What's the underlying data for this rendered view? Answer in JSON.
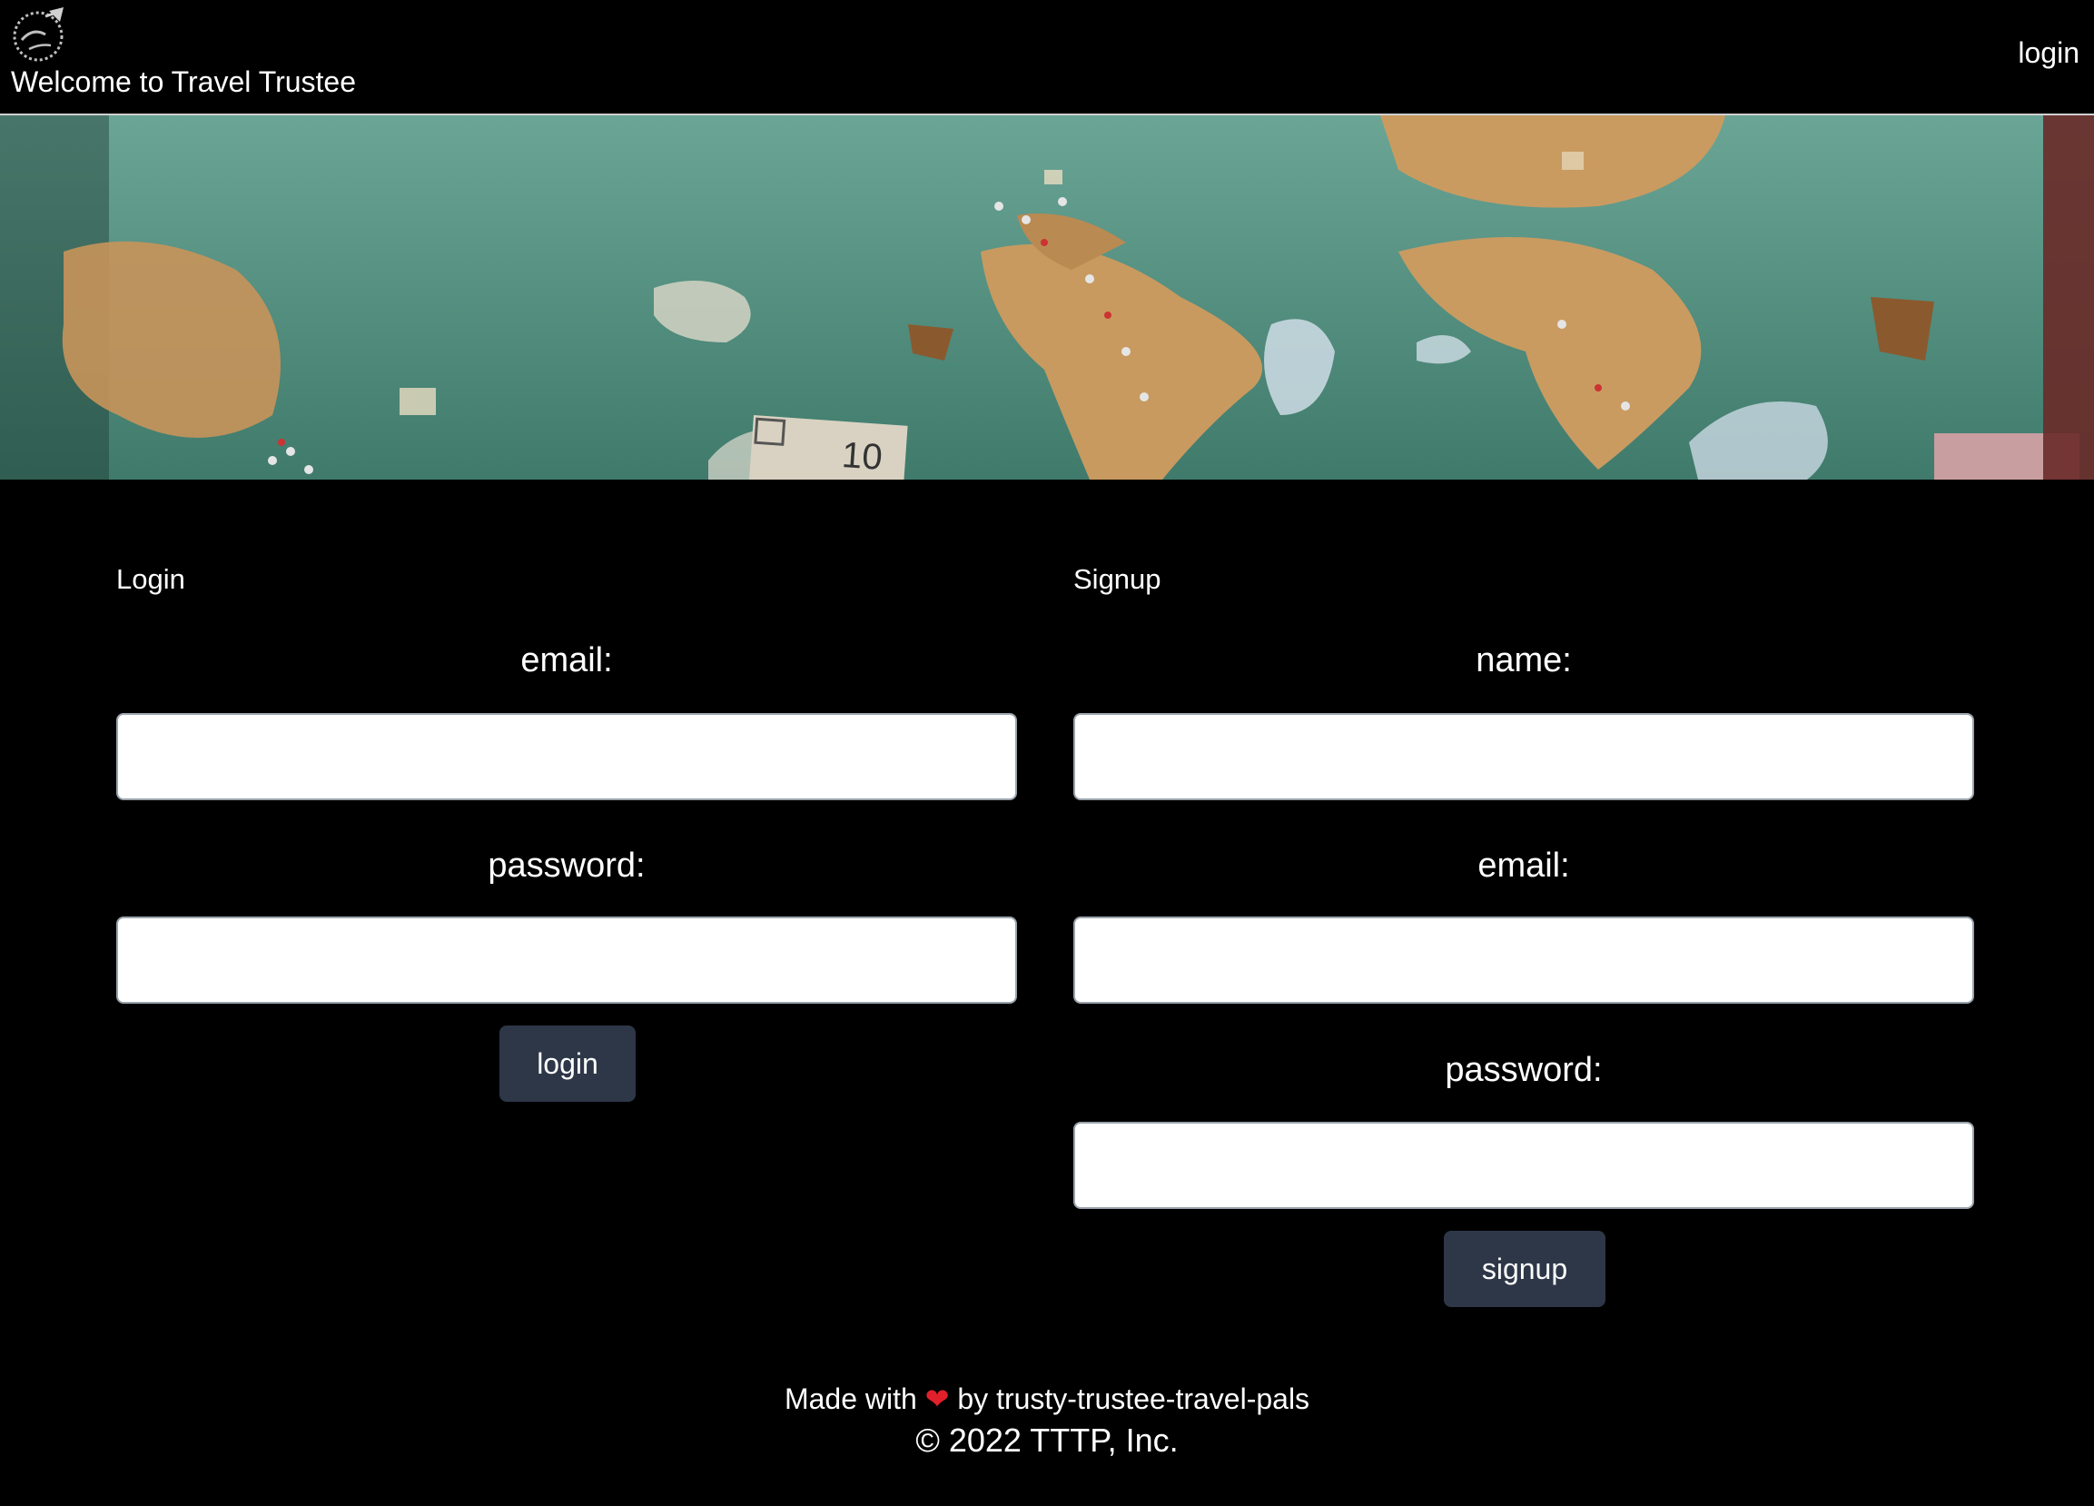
{
  "header": {
    "logo_icon": "globe-plane-icon",
    "title": "Welcome to Travel Trustee",
    "nav_login": "login"
  },
  "banner": {
    "image": "world-map-with-pins-banner",
    "note_text": "10"
  },
  "login_form": {
    "heading": "Login",
    "email_label": "email:",
    "password_label": "password:",
    "email_value": "",
    "password_value": "",
    "submit_label": "login"
  },
  "signup_form": {
    "heading": "Signup",
    "name_label": "name:",
    "email_label": "email:",
    "password_label": "password:",
    "name_value": "",
    "email_value": "",
    "password_value": "",
    "submit_label": "signup"
  },
  "footer": {
    "made_prefix": "Made with",
    "heart_icon": "heart-icon",
    "made_suffix": "by trusty-trustee-travel-pals",
    "copyright": "© 2022 TTTP, Inc."
  },
  "colors": {
    "background": "#000000",
    "button": "#2d3748",
    "text": "#ffffff",
    "heart": "#e0202b"
  }
}
